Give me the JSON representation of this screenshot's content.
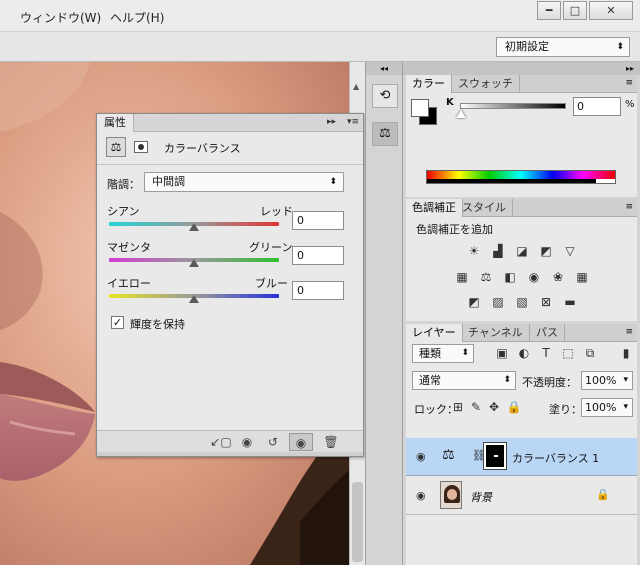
{
  "menubar": {
    "items": [
      "ウィンドウ(W)",
      "ヘルプ(H)"
    ],
    "minimize": "━",
    "maximize": "□",
    "close": "✕"
  },
  "options_bar": {
    "workspace": "初期設定"
  },
  "properties_panel": {
    "tab": "属性",
    "title": "カラーバランス",
    "tone_label": "階調：",
    "tone_value": "中間調",
    "sliders": [
      {
        "left": "シアン",
        "right": "レッド",
        "value": "0",
        "level": 0
      },
      {
        "left": "マゼンタ",
        "right": "グリーン",
        "value": "0",
        "level": 0
      },
      {
        "left": "イエロー",
        "right": "ブルー",
        "value": "0",
        "level": 0
      }
    ],
    "preserve_luminosity": {
      "label": "輝度を保持",
      "checked": true
    }
  },
  "color_panel": {
    "tabs": [
      "カラー",
      "スウォッチ"
    ],
    "channel": "K",
    "value": "0",
    "unit": "%"
  },
  "adjustments_panel": {
    "tabs": [
      "色調補正",
      "スタイル"
    ],
    "add_label": "色調補正を追加"
  },
  "layers_panel": {
    "tabs": [
      "レイヤー",
      "チャンネル",
      "パス"
    ],
    "filter": "種類",
    "blend_mode": "通常",
    "opacity_label": "不透明度：",
    "opacity": "100%",
    "lock_label": "ロック：",
    "fill_label": "塗り：",
    "fill": "100%",
    "layers": [
      {
        "name": "カラーバランス 1",
        "selected": true
      },
      {
        "name": "背景",
        "locked": true
      }
    ]
  },
  "colors": {
    "cyan_red": [
      "#1fd6d6",
      "#e03434"
    ],
    "magenta_green": [
      "#d23bd2",
      "#2fc02f"
    ],
    "yellow_blue": [
      "#e5e520",
      "#2530d8"
    ],
    "selection": "#b9d6f5"
  }
}
